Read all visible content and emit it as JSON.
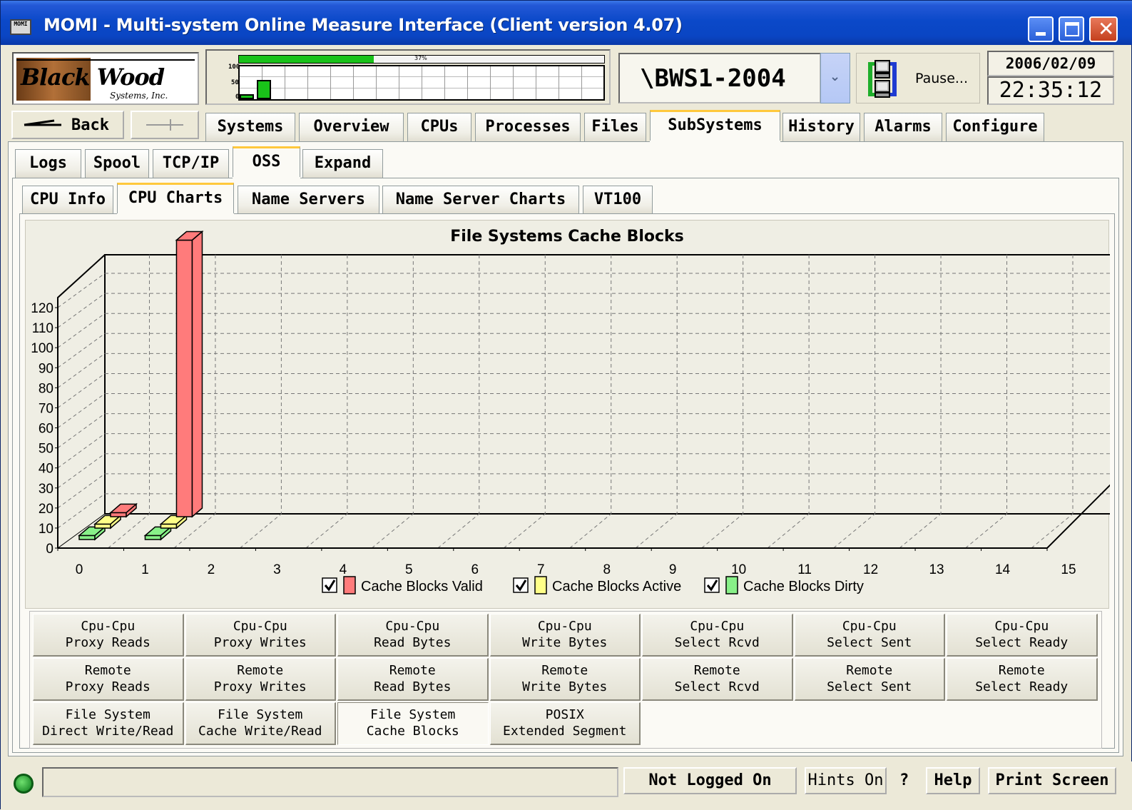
{
  "window": {
    "title": "MOMI - Multi-system Online Measure Interface (Client version 4.07)",
    "icon_text": "MOMI",
    "controls": [
      "minimize-icon",
      "maximize-icon",
      "close-icon"
    ]
  },
  "logo": {
    "line1": "Black Wood",
    "line2": "Systems, Inc."
  },
  "mini_perf": {
    "percent_label": "37%",
    "percent": 37,
    "y_labels": [
      "100",
      "50",
      "0"
    ],
    "bars": [
      15,
      58
    ]
  },
  "system": {
    "name": "\\BWS1-2004",
    "dropdown_icon": "chevron-down-icon"
  },
  "pause": {
    "label": "Pause...",
    "icon": "network-computers-icon"
  },
  "datetime": {
    "date": "2006/02/09",
    "time": "22:35:12"
  },
  "nav": {
    "back_label": "Back",
    "forward_label": "",
    "tabs": [
      "Systems",
      "Overview",
      "CPUs",
      "Processes",
      "Files",
      "SubSystems",
      "History",
      "Alarms",
      "Configure"
    ],
    "active_tab": "SubSystems"
  },
  "sub_tabs": {
    "items": [
      "Logs",
      "Spool",
      "TCP/IP",
      "OSS",
      "Expand"
    ],
    "active": "OSS"
  },
  "oss_tabs": {
    "items": [
      "CPU Info",
      "CPU Charts",
      "Name Servers",
      "Name Server Charts",
      "VT100"
    ],
    "active": "CPU Charts"
  },
  "chart_data": {
    "type": "bar",
    "title": "File Systems Cache Blocks",
    "xlabel": "",
    "ylabel": "",
    "categories": [
      "0",
      "1",
      "2",
      "3",
      "4",
      "5",
      "6",
      "7",
      "8",
      "9",
      "10",
      "11",
      "12",
      "13",
      "14",
      "15"
    ],
    "y_ticks": [
      "0",
      "10",
      "20",
      "30",
      "40",
      "50",
      "60",
      "70",
      "80",
      "90",
      "100",
      "110",
      "120"
    ],
    "ylim": [
      0,
      125
    ],
    "series": [
      {
        "name": "Cache Blocks Valid",
        "color": "#ff7b7b",
        "values": [
          2,
          138
        ]
      },
      {
        "name": "Cache Blocks Active",
        "color": "#ffff88",
        "values": [
          2,
          2
        ]
      },
      {
        "name": "Cache Blocks Dirty",
        "color": "#88f088",
        "values": [
          2,
          2
        ]
      }
    ],
    "legend_checked": [
      true,
      true,
      true
    ],
    "grid": true,
    "legend_position": "bottom"
  },
  "chart_buttons": [
    [
      "Cpu-Cpu",
      "Proxy Reads"
    ],
    [
      "Cpu-Cpu",
      "Proxy Writes"
    ],
    [
      "Cpu-Cpu",
      "Read Bytes"
    ],
    [
      "Cpu-Cpu",
      "Write Bytes"
    ],
    [
      "Cpu-Cpu",
      "Select Rcvd"
    ],
    [
      "Cpu-Cpu",
      "Select Sent"
    ],
    [
      "Cpu-Cpu",
      "Select Ready"
    ],
    [
      "Remote",
      "Proxy Reads"
    ],
    [
      "Remote",
      "Proxy Writes"
    ],
    [
      "Remote",
      "Read Bytes"
    ],
    [
      "Remote",
      "Write Bytes"
    ],
    [
      "Remote",
      "Select Rcvd"
    ],
    [
      "Remote",
      "Select Sent"
    ],
    [
      "Remote",
      "Select Ready"
    ],
    [
      "File System",
      "Direct Write/Read"
    ],
    [
      "File System",
      "Cache Write/Read"
    ],
    [
      "File System",
      "Cache Blocks"
    ],
    [
      "POSIX",
      "Extended Segment"
    ]
  ],
  "selected_chart_button": 16,
  "status": {
    "login_label": "Not Logged On",
    "hints_label": "Hints On",
    "question_label": "?",
    "help_label": "Help",
    "print_label": "Print Screen",
    "message": ""
  },
  "colors": {
    "title_bar": "#0a45c3",
    "active_tab_accent": "#ffc83c",
    "perf_green": "#19c219"
  }
}
